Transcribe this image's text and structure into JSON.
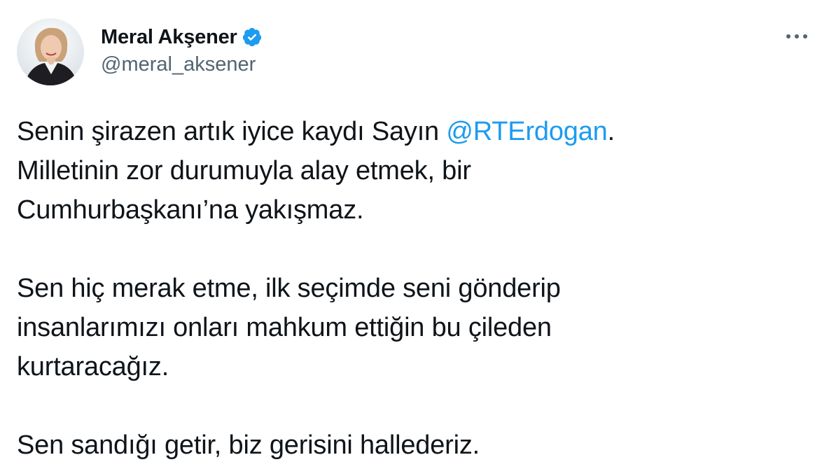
{
  "author": {
    "display_name": "Meral Akşener",
    "handle": "@meral_aksener",
    "verified": true,
    "avatar_icon": "user-avatar"
  },
  "more_icon": "more-options-icon",
  "tweet": {
    "p1": {
      "before": "Senin şirazen artık iyice kaydı Sayın ",
      "mention": "@RTErdogan",
      "after": ".",
      "line2": "Milletinin zor durumuyla alay etmek, bir",
      "line3": "Cumhurbaşkanı’na yakışmaz."
    },
    "p2": {
      "line1": "Sen hiç merak etme, ilk seçimde seni gönderip",
      "line2": "insanlarımızı onları mahkum ettiğin bu çileden",
      "line3": "kurtaracağız."
    },
    "p3": {
      "line1": "Sen sandığı getir, biz gerisini hallederiz."
    }
  },
  "colors": {
    "text": "#0f1419",
    "secondary": "#536471",
    "link": "#1d9bf0",
    "verified": "#1d9bf0"
  }
}
